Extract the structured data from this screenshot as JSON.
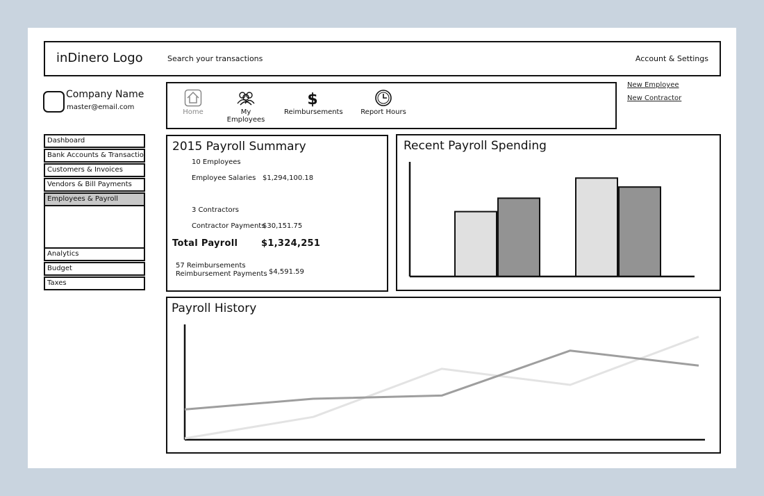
{
  "header": {
    "logo": "inDinero Logo",
    "search_placeholder": "Search your transactions",
    "account": "Account & Settings"
  },
  "company": {
    "name": "Company Name",
    "email": "master@email.com"
  },
  "sidebar": {
    "items_top": [
      {
        "label": "Dashboard",
        "active": false
      },
      {
        "label": "Bank Accounts & Transactions",
        "active": false
      },
      {
        "label": "Customers & Invoices",
        "active": false
      },
      {
        "label": "Vendors & Bill Payments",
        "active": false
      },
      {
        "label": "Employees & Payroll",
        "active": true
      }
    ],
    "items_bottom": [
      {
        "label": "Analytics"
      },
      {
        "label": "Budget"
      },
      {
        "label": "Taxes"
      }
    ]
  },
  "nav": {
    "home": {
      "label": "Home",
      "icon": "home-icon"
    },
    "employees": {
      "label": "My Employees",
      "icon": "people-icon"
    },
    "reimbursements": {
      "label": "Reimbursements",
      "icon": "dollar-icon"
    },
    "hours": {
      "label": "Report Hours",
      "icon": "clock-icon"
    }
  },
  "quick_links": {
    "new_employee": "New Employee",
    "new_contractor": "New Contractor"
  },
  "summary": {
    "title": "2015 Payroll Summary",
    "employees_count": "10 Employees",
    "salaries_label": "Employee Salaries",
    "salaries_value": "$1,294,100.18",
    "contractors_count": "3 Contractors",
    "contractor_label": "Contractor Payments",
    "contractor_value": "$30,151.75",
    "total_label": "Total Payroll",
    "total_value": "$1,324,251",
    "reimb_count": "57 Reimbursements",
    "reimb_label": "Reimbursement Payments",
    "reimb_value": "$4,591.59"
  },
  "spending": {
    "title": "Recent Payroll Spending"
  },
  "history": {
    "title": "Payroll History"
  },
  "chart_data": [
    {
      "type": "bar",
      "title": "Recent Payroll Spending",
      "categories": [
        "",
        ""
      ],
      "series": [
        {
          "color": "#e0e0e0",
          "values": [
            58,
            88
          ]
        },
        {
          "color": "#939393",
          "values": [
            70,
            80
          ]
        }
      ],
      "ylim": [
        0,
        100
      ],
      "grid": false
    },
    {
      "type": "line",
      "title": "Payroll History",
      "x": [
        0,
        1,
        2,
        3,
        4
      ],
      "series": [
        {
          "color": "#9e9e9e",
          "values": [
            27,
            37,
            40,
            82,
            68
          ]
        },
        {
          "color": "#e3e3e3",
          "values": [
            0,
            20,
            65,
            50,
            95
          ]
        }
      ],
      "ylim": [
        0,
        100
      ],
      "grid": false
    }
  ]
}
